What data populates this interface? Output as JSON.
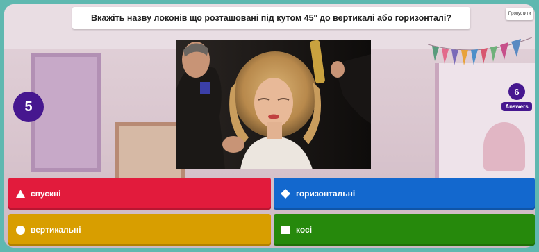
{
  "question": {
    "text": "Вкажіть назву локонів що розташовані під кутом 45° до вертикалі або горизонталі?"
  },
  "skip_button": {
    "label": "Пропустити"
  },
  "timer": {
    "value": "5"
  },
  "answers_count": {
    "value": "6",
    "label": "Answers"
  },
  "image": {
    "subject": "photo"
  },
  "answers": [
    {
      "label": "спускні",
      "shape": "triangle-icon",
      "color": "#e21b3c"
    },
    {
      "label": "горизонтальні",
      "shape": "diamond-icon",
      "color": "#1368ce"
    },
    {
      "label": "вертикальні",
      "shape": "circle-icon",
      "color": "#d89e00"
    },
    {
      "label": "косі",
      "shape": "square-icon",
      "color": "#26890c"
    }
  ],
  "colors": {
    "accent": "#46178f",
    "frame": "#5fb8b0"
  }
}
